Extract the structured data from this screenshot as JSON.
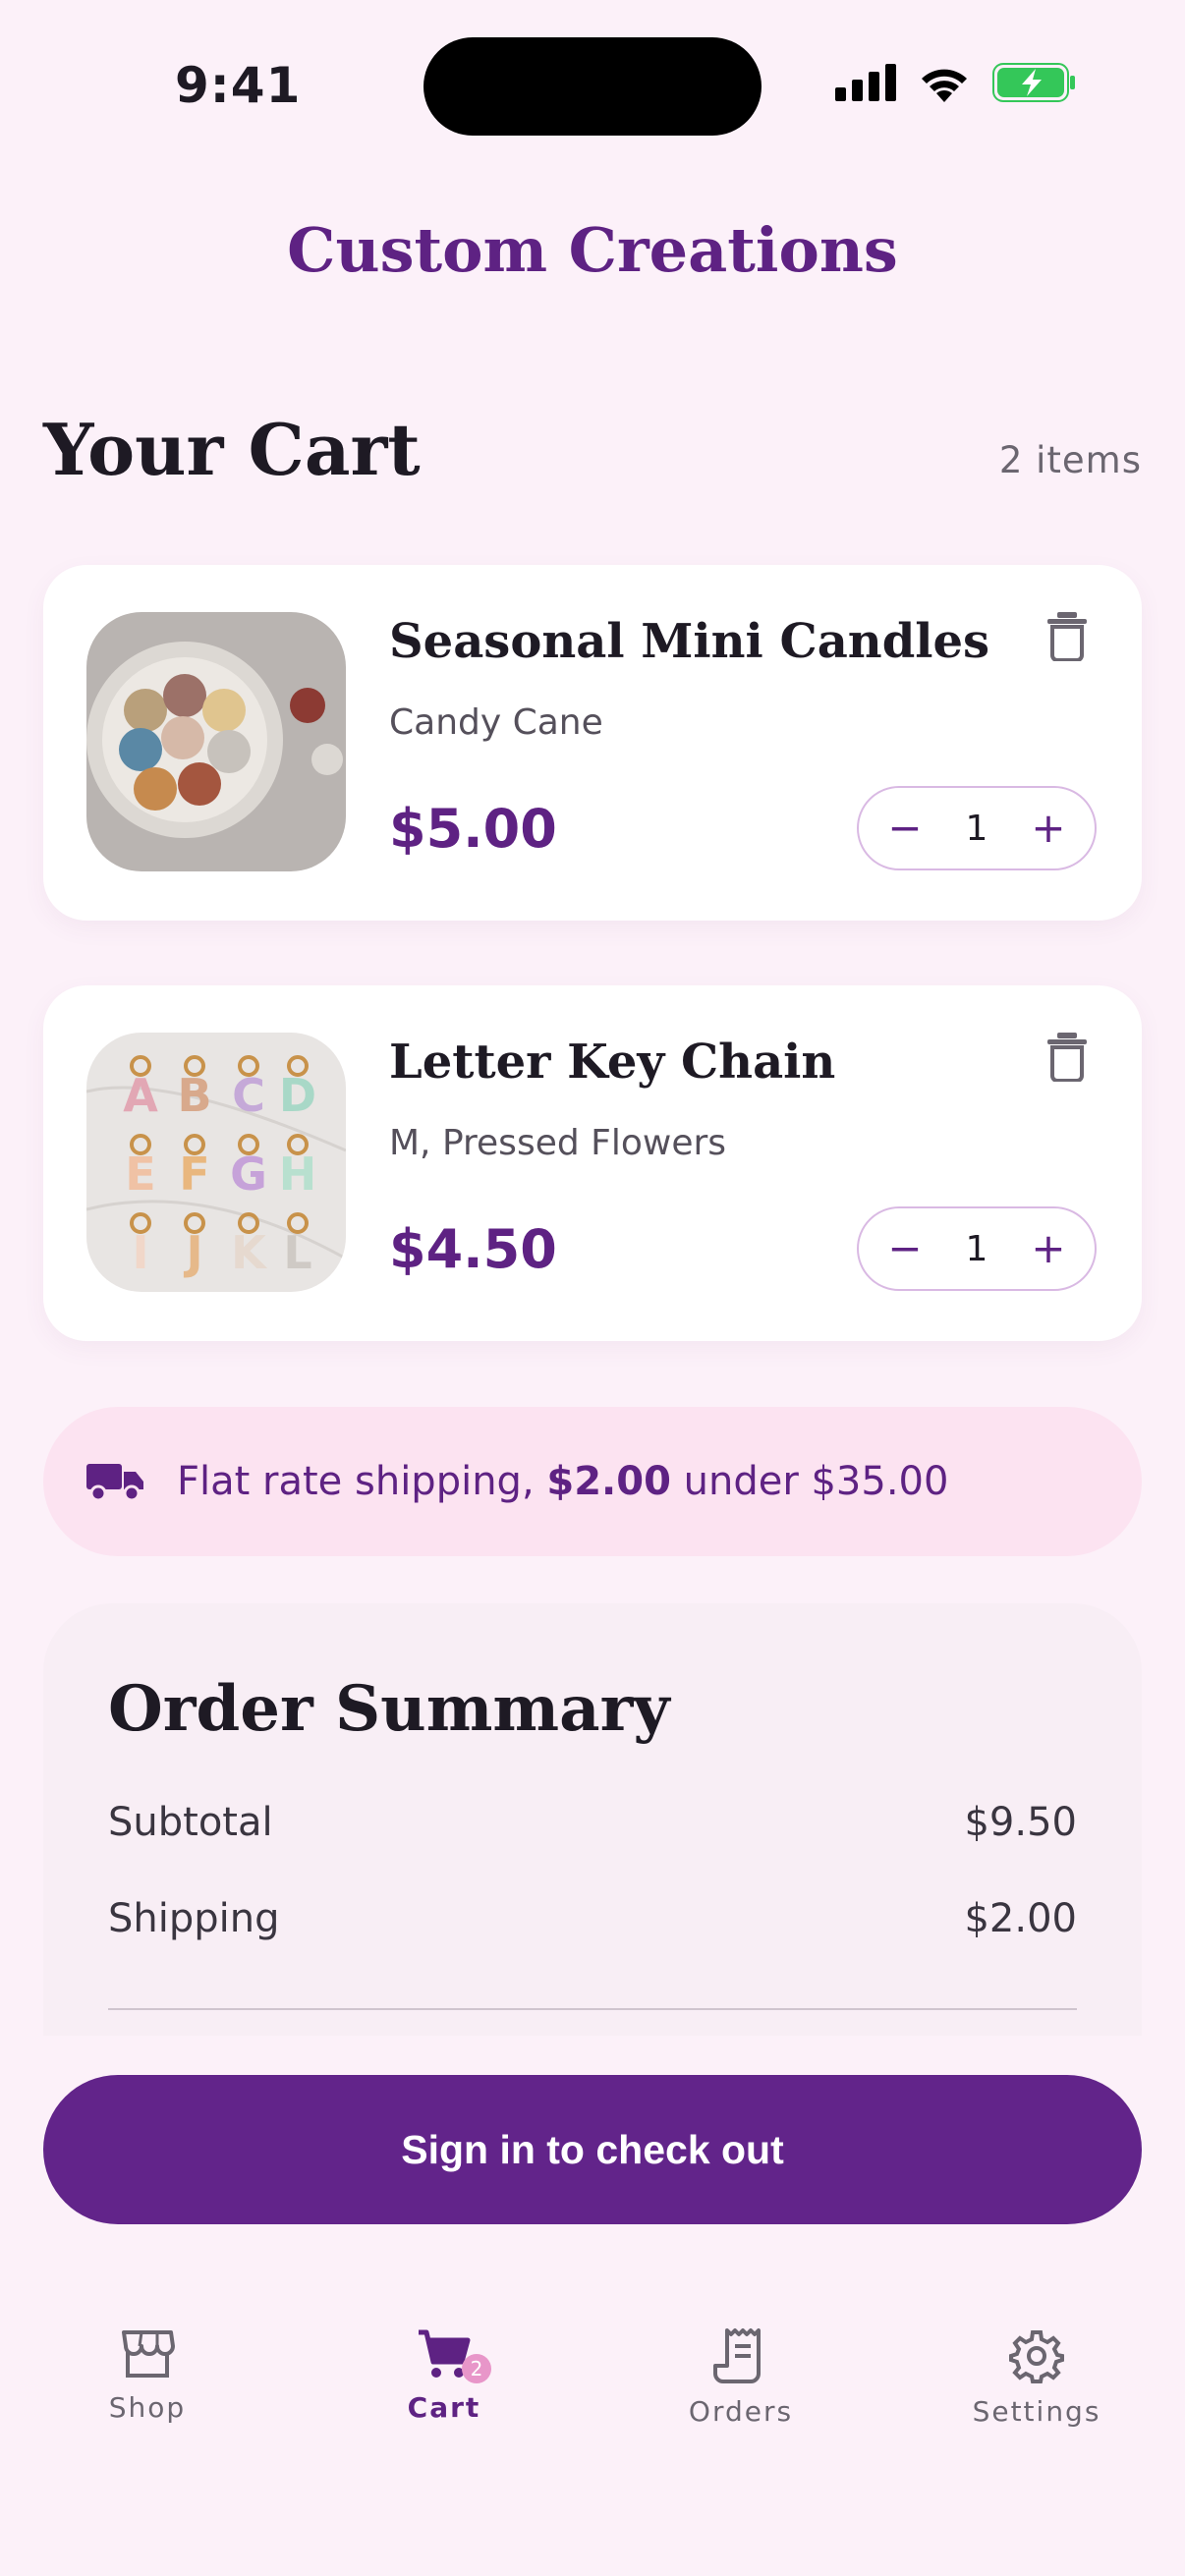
{
  "status_bar": {
    "time": "9:41"
  },
  "app": {
    "title": "Custom Creations"
  },
  "cart": {
    "heading": "Your Cart",
    "count": "2 items",
    "items": [
      {
        "name": "Seasonal Mini Candles",
        "variant": "Candy Cane",
        "price": "$5.00",
        "quantity": "1"
      },
      {
        "name": "Letter Key Chain",
        "variant": "M, Pressed Flowers",
        "price": "$4.50",
        "quantity": "1"
      }
    ],
    "stepper": {
      "minus": "−",
      "plus": "+"
    }
  },
  "shipping_notice": {
    "prefix": "Flat rate shipping, ",
    "amount": "$2.00",
    "suffix": " under $35.00"
  },
  "order_summary": {
    "title": "Order Summary",
    "rows": [
      {
        "label": "Subtotal",
        "value": "$9.50"
      },
      {
        "label": "Shipping",
        "value": "$2.00"
      }
    ]
  },
  "checkout_button": "Sign in to check out",
  "nav": {
    "items": [
      {
        "label": "Shop",
        "icon": "storefront-icon"
      },
      {
        "label": "Cart",
        "icon": "cart-icon",
        "badge": "2"
      },
      {
        "label": "Orders",
        "icon": "receipt-icon"
      },
      {
        "label": "Settings",
        "icon": "gear-icon"
      }
    ],
    "active": "Cart"
  },
  "colors": {
    "accent": "#5E2283",
    "button": "#62248A",
    "background": "#FCF1F9",
    "shipping_bg": "#FCE3F1"
  }
}
